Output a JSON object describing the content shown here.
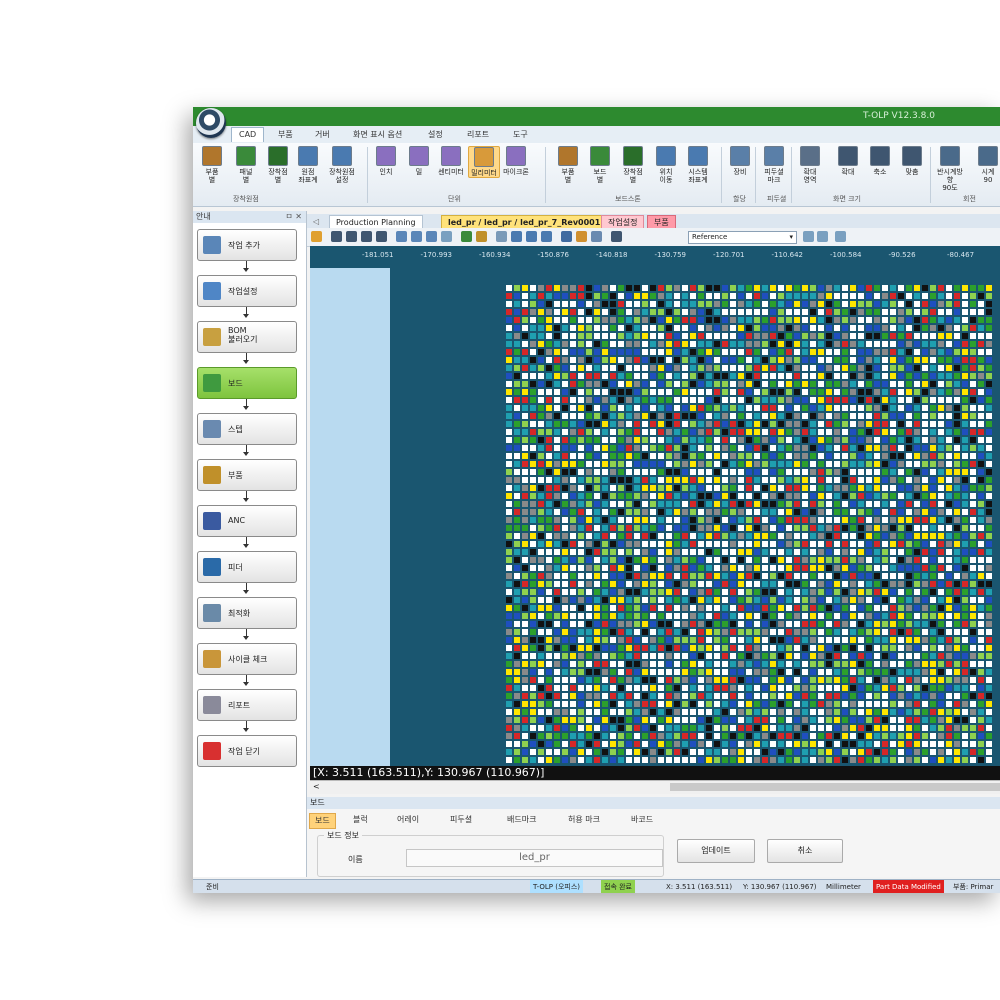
{
  "app": {
    "title": "T-OLP V12.3.8.0"
  },
  "menu_tabs": [
    "CAD",
    "부품",
    "거버",
    "화면 표시 옵션",
    "설정",
    "리포트",
    "도구"
  ],
  "ribbon": {
    "buttons": [
      {
        "label": "부품\n별",
        "icon": "parts-icon",
        "color": "#b0762c"
      },
      {
        "label": "패널\n별",
        "icon": "panel-icon",
        "color": "#3a8a3a"
      },
      {
        "label": "장착점\n별",
        "icon": "mount-point-icon",
        "color": "#2a6e2a"
      },
      {
        "label": "원점\n좌표계",
        "icon": "origin-icon",
        "color": "#4a7ab0"
      },
      {
        "label": "장착원점\n설정",
        "icon": "mount-origin-icon",
        "color": "#4a7ab0"
      },
      {
        "label": "인치",
        "icon": "inch-icon",
        "color": "#8a6fbf"
      },
      {
        "label": "밀",
        "icon": "mil-icon",
        "color": "#8a6fbf"
      },
      {
        "label": "센티미터",
        "icon": "centimeter-icon",
        "color": "#8a6fbf"
      },
      {
        "label": "밀리미터",
        "icon": "millimeter-icon",
        "color": "#d89a3a"
      },
      {
        "label": "마이크론",
        "icon": "micron-icon",
        "color": "#8a6fbf"
      },
      {
        "label": "부품\n별",
        "icon": "parts-icon",
        "color": "#b0762c"
      },
      {
        "label": "보드\n별",
        "icon": "board-icon",
        "color": "#3a8a3a"
      },
      {
        "label": "장착점\n별",
        "icon": "mount-point-icon",
        "color": "#2a6e2a"
      },
      {
        "label": "위치\n이동",
        "icon": "move-icon",
        "color": "#4a7ab0"
      },
      {
        "label": "시스템\n좌표계",
        "icon": "system-coord-icon",
        "color": "#4a7ab0"
      },
      {
        "label": "장비",
        "icon": "equipment-icon",
        "color": "#5a7fa8"
      },
      {
        "label": "피두셜\n마크",
        "icon": "fiducial-icon",
        "color": "#5a7fa8"
      },
      {
        "label": "확대\n영역",
        "icon": "zoom-area-icon",
        "color": "#5a6f88"
      },
      {
        "label": "확대",
        "icon": "zoom-in-icon",
        "color": "#3f5670"
      },
      {
        "label": "축소",
        "icon": "zoom-out-icon",
        "color": "#3f5670"
      },
      {
        "label": "맞춤",
        "icon": "zoom-fit-icon",
        "color": "#3f5670"
      },
      {
        "label": "반시계방향\n90도",
        "icon": "rotate-ccw-icon",
        "color": "#4a6a8a"
      },
      {
        "label": "시계\n90",
        "icon": "rotate-cw-icon",
        "color": "#4a6a8a"
      }
    ],
    "groups": [
      "장착원점",
      "단위",
      "보드스톤",
      "할당",
      "피두셜",
      "화면 크기",
      "회전"
    ]
  },
  "left_panel": {
    "title": "안내",
    "pin": "ㅁ ✕",
    "steps": [
      {
        "label": "작업 추가",
        "icon": "add-job-icon",
        "active": false
      },
      {
        "label": "작업설정",
        "icon": "job-settings-icon",
        "active": false
      },
      {
        "label": "BOM\n불러오기",
        "icon": "bom-import-icon",
        "active": false
      },
      {
        "label": "보드",
        "icon": "board-icon",
        "active": true
      },
      {
        "label": "스텝",
        "icon": "step-icon",
        "active": false
      },
      {
        "label": "부품",
        "icon": "component-icon",
        "active": false
      },
      {
        "label": "ANC",
        "icon": "anc-icon",
        "active": false
      },
      {
        "label": "피더",
        "icon": "feeder-icon",
        "active": false
      },
      {
        "label": "최적화",
        "icon": "optimize-icon",
        "active": false
      },
      {
        "label": "사이클 체크",
        "icon": "cycle-check-icon",
        "active": false
      },
      {
        "label": "리포트",
        "icon": "report-icon",
        "active": false
      },
      {
        "label": "작업 닫기",
        "icon": "close-job-icon",
        "active": false
      }
    ]
  },
  "doc_tabs": [
    {
      "label": "Production Planning",
      "style": "plain"
    },
    {
      "label": "led_pr / led_pr / led_pr_7_Rev0001",
      "style": "yellow",
      "close": "✕"
    },
    {
      "label": "작업설정",
      "style": "pink"
    },
    {
      "label": "부품",
      "style": "pink"
    }
  ],
  "view_toolbar": {
    "reference": "Reference"
  },
  "ruler_ticks": [
    "-181.051",
    "-170.993",
    "-160.934",
    "-150.876",
    "-140.818",
    "-130.759",
    "-120.701",
    "-110.642",
    "-100.584",
    "-90.526",
    "-80.467"
  ],
  "coordinate_readout": "[X: 3.511 (163.511),Y: 130.967 (110.967)]",
  "scroll_left": "<",
  "bottom_panel": {
    "title": "보드",
    "tabs": [
      "보드",
      "블럭",
      "어레이",
      "피두셜",
      "배드마크",
      "허용 마크",
      "바코드"
    ],
    "group_title": "보드 정보",
    "name_label": "이름",
    "name_value": "led_pr",
    "update_button": "업데이트",
    "cancel_button": "취소"
  },
  "status_bar": {
    "ready": "준비",
    "mode": "T-OLP (오피스)",
    "connection": "접속 완료",
    "x": "X: 3.511 (163.511)",
    "y": "Y: 130.967 (110.967)",
    "unit": "Millimeter",
    "modified": "Part Data Modified",
    "part": "부품: Primar"
  },
  "colors": {
    "titlebar": "#2d8a2f",
    "canvas_bg": "#1a5670",
    "active_step": "#8ccd4d",
    "status_green": "#8fd14f",
    "status_red": "#e02020"
  }
}
